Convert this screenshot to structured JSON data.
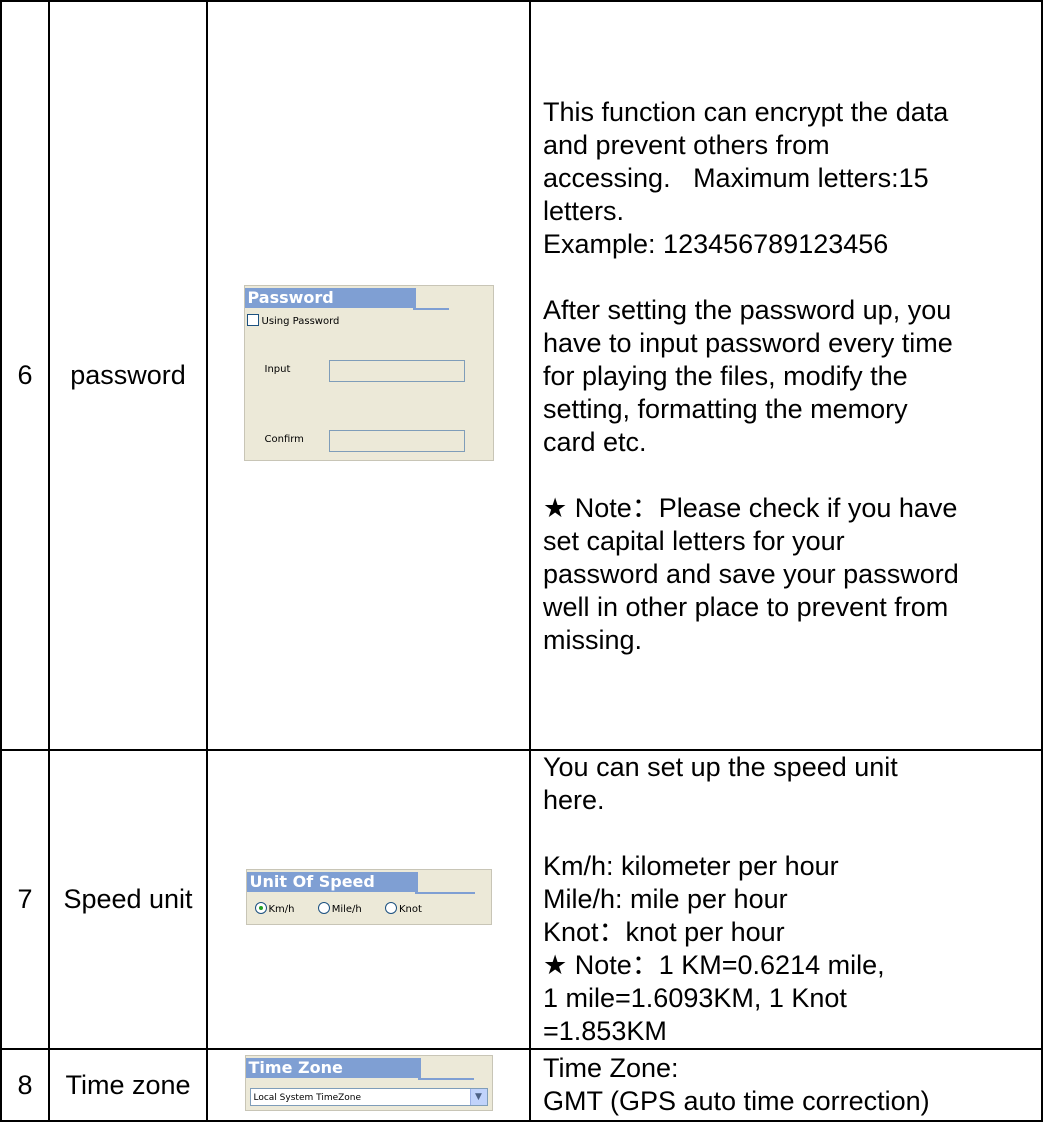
{
  "rows": [
    {
      "no": "6",
      "name": "password",
      "panel": {
        "title": "Password",
        "checkbox_label": "Using Password",
        "input_label": "Input",
        "confirm_label": "Confirm"
      },
      "desc": [
        "This function can encrypt the data",
        "and prevent others from",
        "accessing.   Maximum letters:15",
        "letters.",
        "Example: 123456789123456",
        "",
        "After setting the password up, you",
        "have to input password every time",
        "for playing the files, modify the",
        "setting, formatting the memory",
        "card etc.",
        "",
        "★ Note：Please check if you have",
        "set capital letters for your",
        "password and save your password",
        "well in other place to prevent from",
        "missing."
      ]
    },
    {
      "no": "7",
      "name": "Speed unit",
      "panel": {
        "title": "Unit Of Speed",
        "options": [
          "Km/h",
          "Mile/h",
          "Knot"
        ],
        "selected": "Km/h"
      },
      "desc": [
        "You can set up the speed unit",
        "here.",
        "",
        "Km/h: kilometer per hour",
        "Mile/h: mile per hour",
        "Knot：knot per hour",
        "★ Note：1 KM=0.6214 mile,",
        "1 mile=1.6093KM, 1 Knot",
        "=1.853KM"
      ]
    },
    {
      "no": "8",
      "name": "Time zone",
      "panel": {
        "title": "Time Zone",
        "select_value": "Local System TimeZone"
      },
      "desc": [
        "Time Zone:",
        "GMT (GPS auto time correction)"
      ]
    }
  ]
}
